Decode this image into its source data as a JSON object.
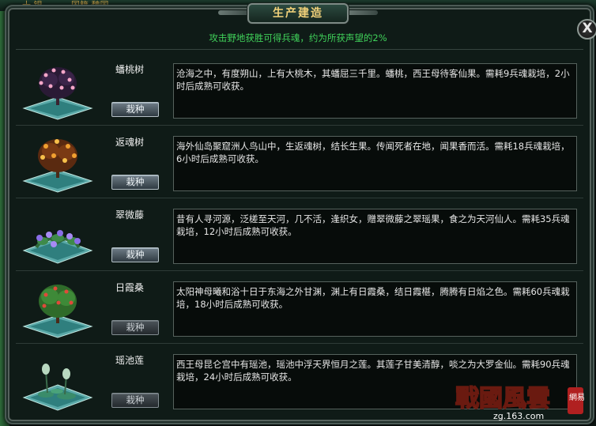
{
  "window": {
    "title": "生产建造",
    "notice": "攻击野地获胜可得兵魂，约为所获声望的2%",
    "close_label": "X"
  },
  "background": {
    "frag1": "十 银",
    "frag2": "国籍 魏国"
  },
  "plants": [
    {
      "name": "蟠桃树",
      "description": "沧海之中，有度朔山，上有大桃木，其蟠屈三千里。蟠桃，西王母待客仙果。需耗9兵魂栽培，2小时后成熟可收获。",
      "button_label": "栽种",
      "button_enabled": true,
      "icon": "peach-tree-icon"
    },
    {
      "name": "返魂树",
      "description": "海外仙岛聚窟洲人鸟山中，生返魂树，结长生果。传闻死者在地，闻果香而活。需耗18兵魂栽培，6小时后成熟可收获。",
      "button_label": "栽种",
      "button_enabled": true,
      "icon": "revival-tree-icon"
    },
    {
      "name": "翠微藤",
      "description": "昔有人寻河源，泛槎至天河，几不活，逢织女，赠翠微藤之翠瑶果，食之为天河仙人。需耗35兵魂栽培，12小时后成熟可收获。",
      "button_label": "栽种",
      "button_enabled": true,
      "icon": "jade-vine-icon"
    },
    {
      "name": "日霞桑",
      "description": "太阳神母曦和浴十日于东海之外甘渊，渊上有日霞桑，结日霞椹，腾腾有日焰之色。需耗60兵魂栽培，18小时后成熟可收获。",
      "button_label": "栽种",
      "button_enabled": false,
      "icon": "sun-mulberry-icon"
    },
    {
      "name": "瑶池莲",
      "description": "西王母昆仑宫中有瑶池，瑶池中浮天界恒月之莲。其莲子甘美清醇，啖之为大罗金仙。需耗90兵魂栽培，24小时后成熟可收获。",
      "button_label": "栽种",
      "button_enabled": false,
      "icon": "jade-lotus-icon"
    }
  ],
  "logo": {
    "main": "戰國風雲",
    "site": "zg.163.com",
    "seal": "網易"
  },
  "colors": {
    "notice": "#40d25a",
    "title": "#f2d27a",
    "peach_fruit": "#f4a6c8",
    "revival_glow": "#f0a030",
    "vine_flower": "#8a6ee8",
    "sun_berry": "#e04a3a",
    "lotus": "#3a8c6a"
  }
}
